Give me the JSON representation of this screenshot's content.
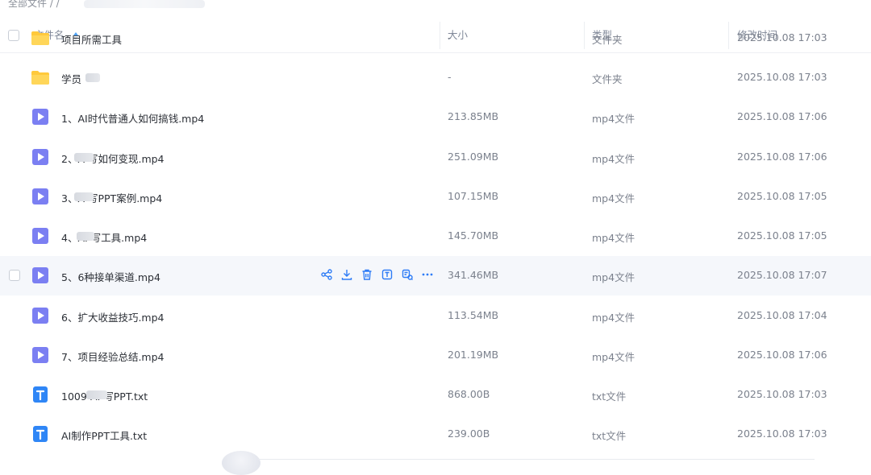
{
  "breadcrumb": {
    "text": "全部文件 / /"
  },
  "header": {
    "name": "文件名",
    "size": "大小",
    "type": "类型",
    "modified": "修改时间"
  },
  "rows": [
    {
      "name": "项目所需工具",
      "icon": "folder-icon",
      "size": "-",
      "type": "文件夹",
      "time": "2025.10.08 17:03"
    },
    {
      "name": "学员",
      "icon": "folder-icon",
      "size": "-",
      "type": "文件夹",
      "time": "2025.10.08 17:03"
    },
    {
      "name": "1、AI时代普通人如何搞钱.mp4",
      "icon": "video-icon",
      "size": "213.85MB",
      "type": "mp4文件",
      "time": "2025.10.08 17:06"
    },
    {
      "name": "2、A  写如何变现.mp4",
      "icon": "video-icon",
      "size": "251.09MB",
      "type": "mp4文件",
      "time": "2025.10.08 17:06"
    },
    {
      "name": "3、A  写PPT案例.mp4",
      "icon": "video-icon",
      "size": "107.15MB",
      "type": "mp4文件",
      "time": "2025.10.08 17:05"
    },
    {
      "name": "4、AI  写工具.mp4",
      "icon": "video-icon",
      "size": "145.70MB",
      "type": "mp4文件",
      "time": "2025.10.08 17:05"
    },
    {
      "name": "5、6种接单渠道.mp4",
      "icon": "video-icon",
      "size": "341.46MB",
      "type": "mp4文件",
      "time": "2025.10.08 17:07"
    },
    {
      "name": "6、扩大收益技巧.mp4",
      "icon": "video-icon",
      "size": "113.54MB",
      "type": "mp4文件",
      "time": "2025.10.08 17:04"
    },
    {
      "name": "7、项目经验总结.mp4",
      "icon": "video-icon",
      "size": "201.19MB",
      "type": "mp4文件",
      "time": "2025.10.08 17:06"
    },
    {
      "name": "1009-AI  写PPT.txt",
      "icon": "text-file-icon",
      "size": "868.00B",
      "type": "txt文件",
      "time": "2025.10.08 17:03"
    },
    {
      "name": "AI制作PPT工具.txt",
      "icon": "text-file-icon",
      "size": "239.00B",
      "type": "txt文件",
      "time": "2025.10.08 17:03"
    }
  ],
  "row_actions": [
    "share-icon",
    "download-icon",
    "delete-icon",
    "rename-icon",
    "copy-link-icon",
    "more-icon"
  ],
  "colors": {
    "accent": "#2e7cf6",
    "folder": "#ffc93c",
    "video": "#7b7ff2",
    "text_file": "#2f86f6"
  }
}
